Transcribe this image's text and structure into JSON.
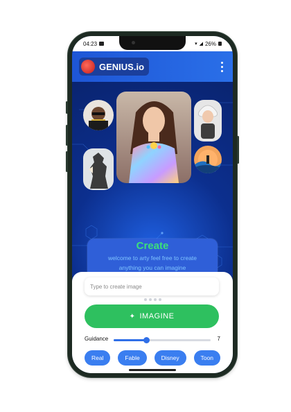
{
  "status": {
    "time": "04:23",
    "battery": "26%"
  },
  "app": {
    "name": "GENIUS.io"
  },
  "hero": {
    "title": "Create",
    "subtitle": "welcome to arty feel free to create anything you can imagine"
  },
  "prompt": {
    "placeholder": "Type to create image",
    "value": ""
  },
  "actions": {
    "imagine_label": "IMAGINE",
    "imagine_icon": "sparkle-icon"
  },
  "guidance": {
    "label": "Guidance",
    "value": "7",
    "fraction": 0.34
  },
  "styles": [
    "Real",
    "Fable",
    "Disney",
    "Toon"
  ],
  "colors": {
    "accent": "#2a6fe8",
    "imagine": "#2ec05f",
    "create_title": "#3ce07a",
    "chip": "#3a7ef0"
  }
}
